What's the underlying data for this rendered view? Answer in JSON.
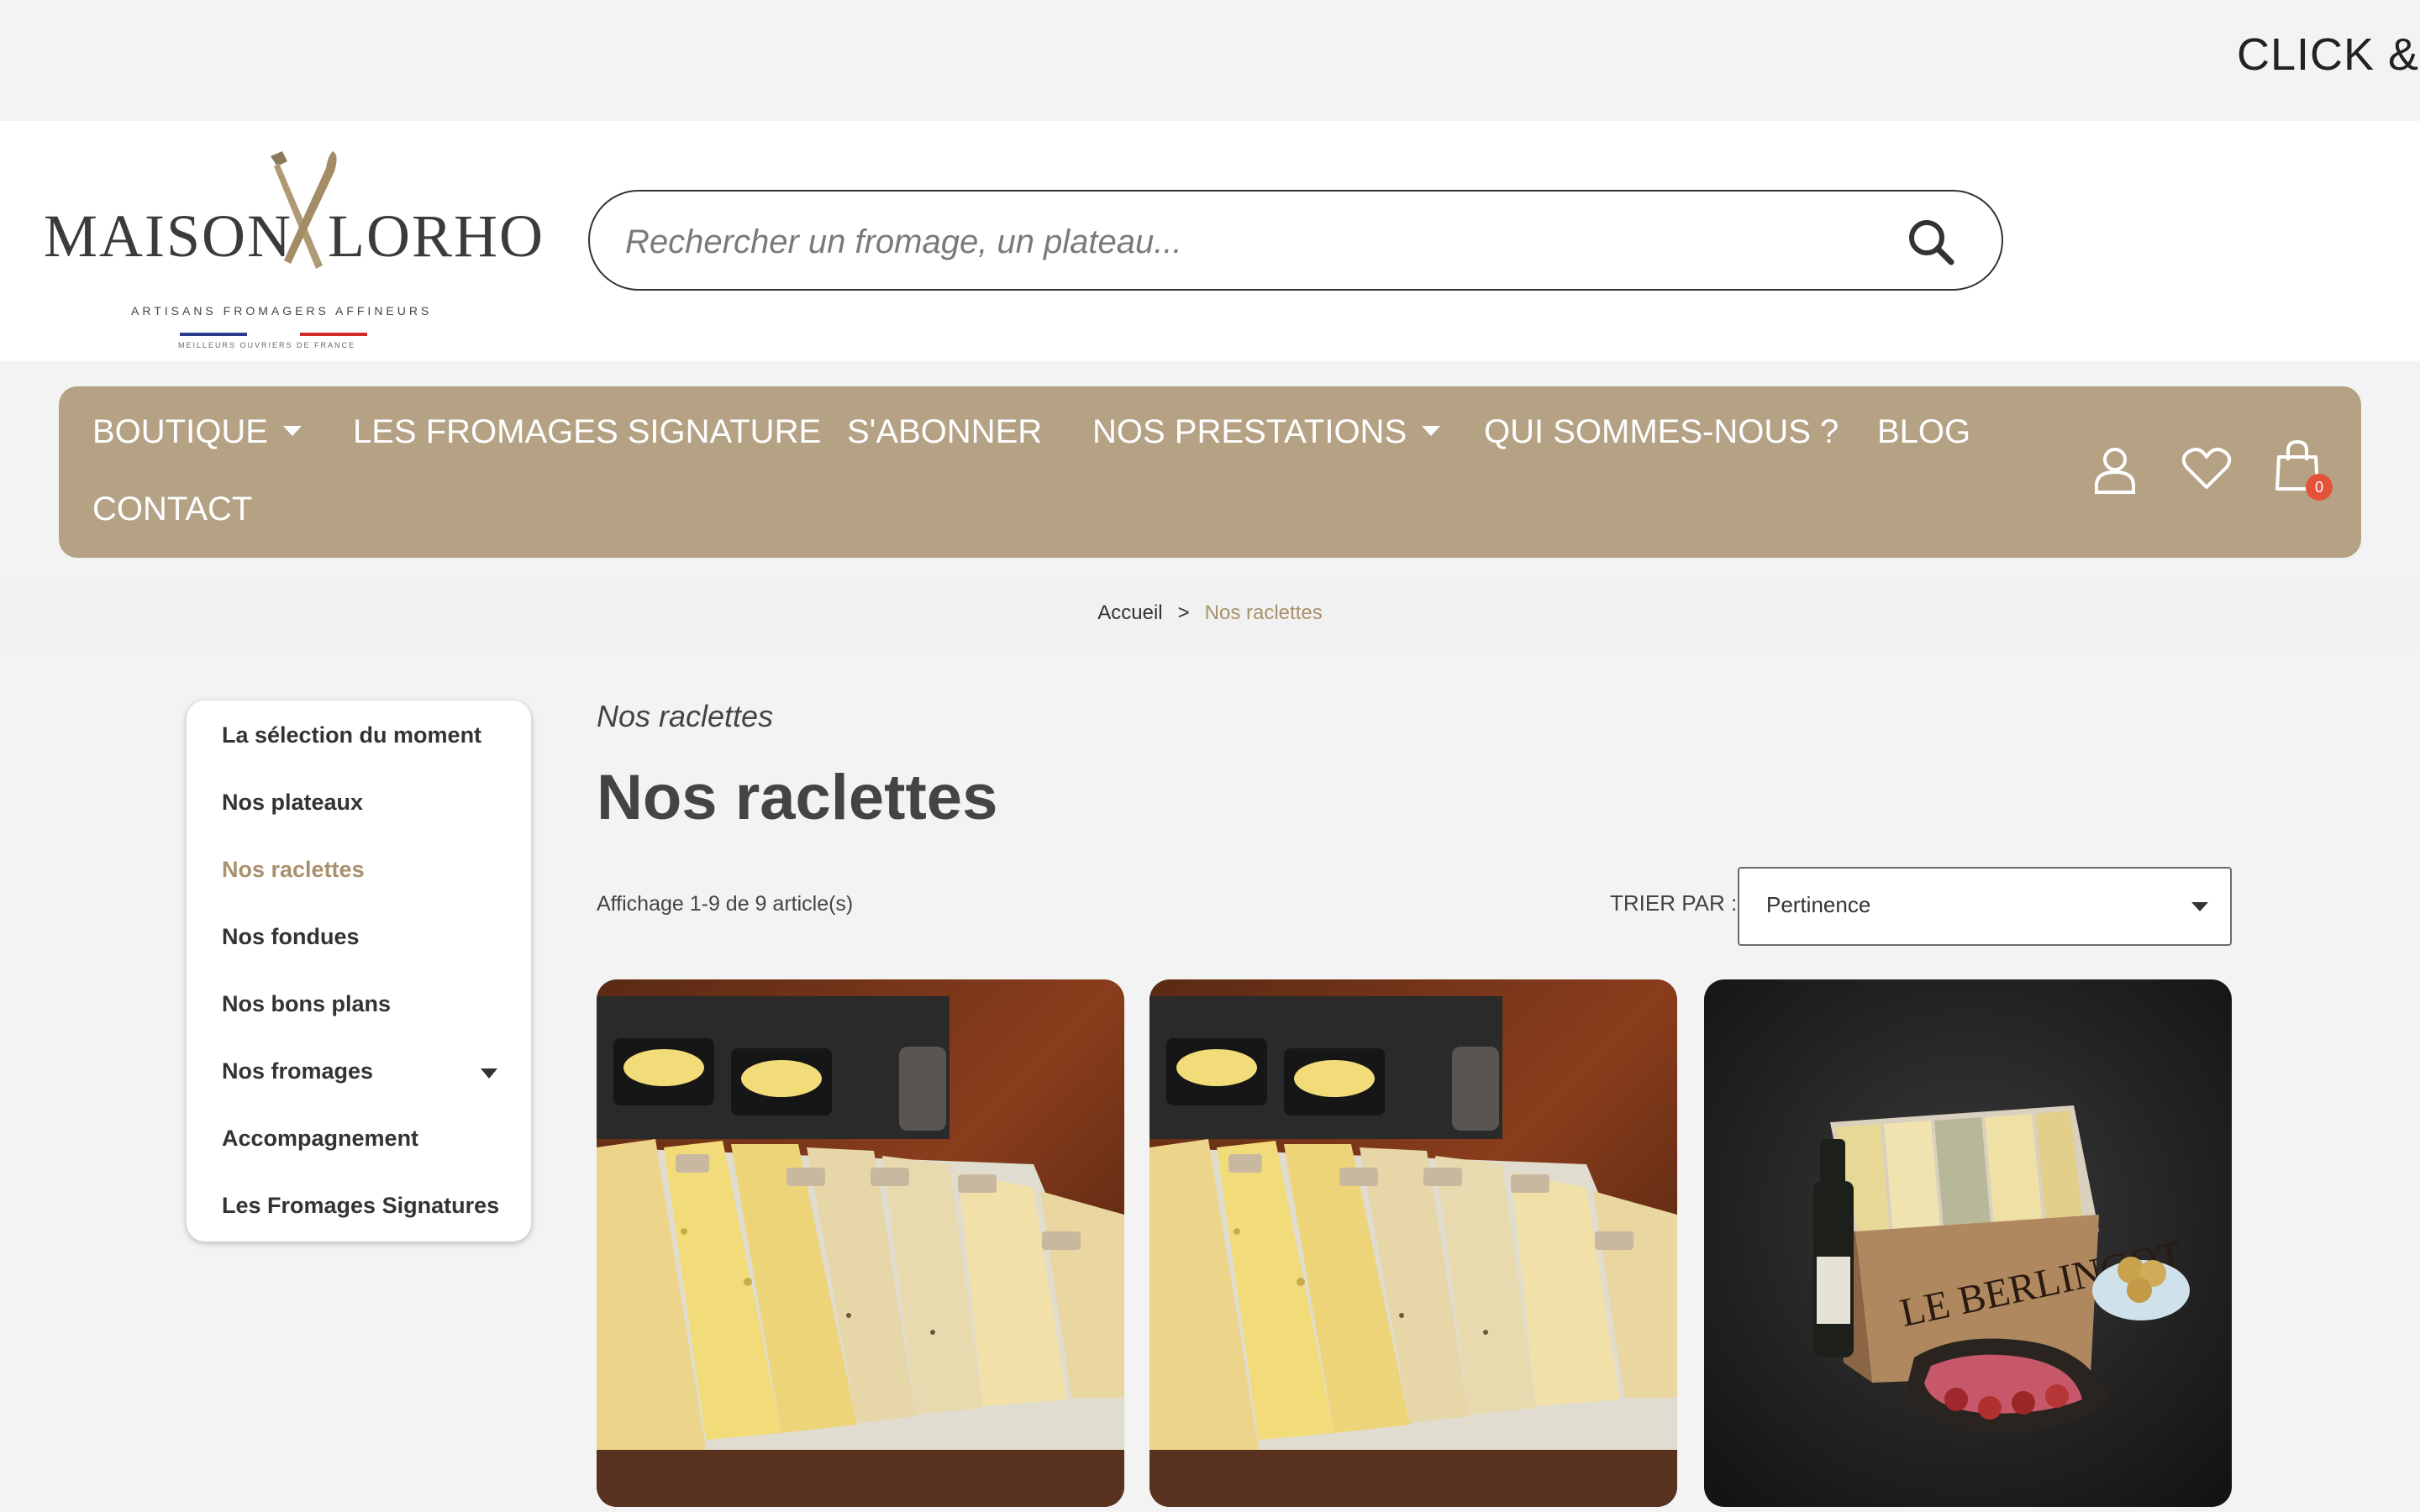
{
  "banner": {
    "text": "CLICK & C"
  },
  "logo": {
    "word_left": "MAISON",
    "word_right": "LORHO",
    "tagline": "ARTISANS FROMAGERS AFFINEURS",
    "subline": "MEILLEURS OUVRIERS DE FRANCE"
  },
  "search": {
    "placeholder": "Rechercher un fromage, un plateau..."
  },
  "nav": {
    "items": [
      {
        "label": "BOUTIQUE",
        "has_caret": true
      },
      {
        "label": "LES FROMAGES SIGNATURE",
        "has_caret": false
      },
      {
        "label": "S'ABONNER",
        "has_caret": false
      },
      {
        "label": "NOS PRESTATIONS",
        "has_caret": true
      },
      {
        "label": "QUI SOMMES-NOUS ?",
        "has_caret": false
      },
      {
        "label": "BLOG",
        "has_caret": false
      },
      {
        "label": "CONTACT",
        "has_caret": false
      }
    ],
    "cart_count": "0",
    "icons": [
      "user-icon",
      "heart-icon",
      "cart-icon"
    ],
    "bg_color": "#b5a285"
  },
  "breadcrumb": {
    "home": "Accueil",
    "separator": ">",
    "current": "Nos raclettes"
  },
  "sidebar": {
    "items": [
      {
        "label": "La sélection du moment",
        "active": false
      },
      {
        "label": "Nos plateaux",
        "active": false
      },
      {
        "label": "Nos raclettes",
        "active": true
      },
      {
        "label": "Nos fondues",
        "active": false
      },
      {
        "label": "Nos bons plans",
        "active": false
      },
      {
        "label": "Nos fromages",
        "active": false,
        "has_caret": true
      },
      {
        "label": "Accompagnement",
        "active": false
      },
      {
        "label": "Les Fromages Signatures",
        "active": false
      }
    ]
  },
  "main": {
    "kicker": "Nos raclettes",
    "title": "Nos raclettes",
    "count": "Affichage 1-9 de 9 article(s)",
    "sort_label": "TRIER PAR :",
    "sort_value": "Pertinence"
  },
  "products": [
    {
      "image": "raclette-platter-photo",
      "box_text": ""
    },
    {
      "image": "raclette-platter-photo",
      "box_text": ""
    },
    {
      "image": "berlingot-box-photo",
      "box_text": "LE BERLINGOT"
    }
  ],
  "colors": {
    "accent": "#a8916c",
    "badge": "#e4523a"
  }
}
